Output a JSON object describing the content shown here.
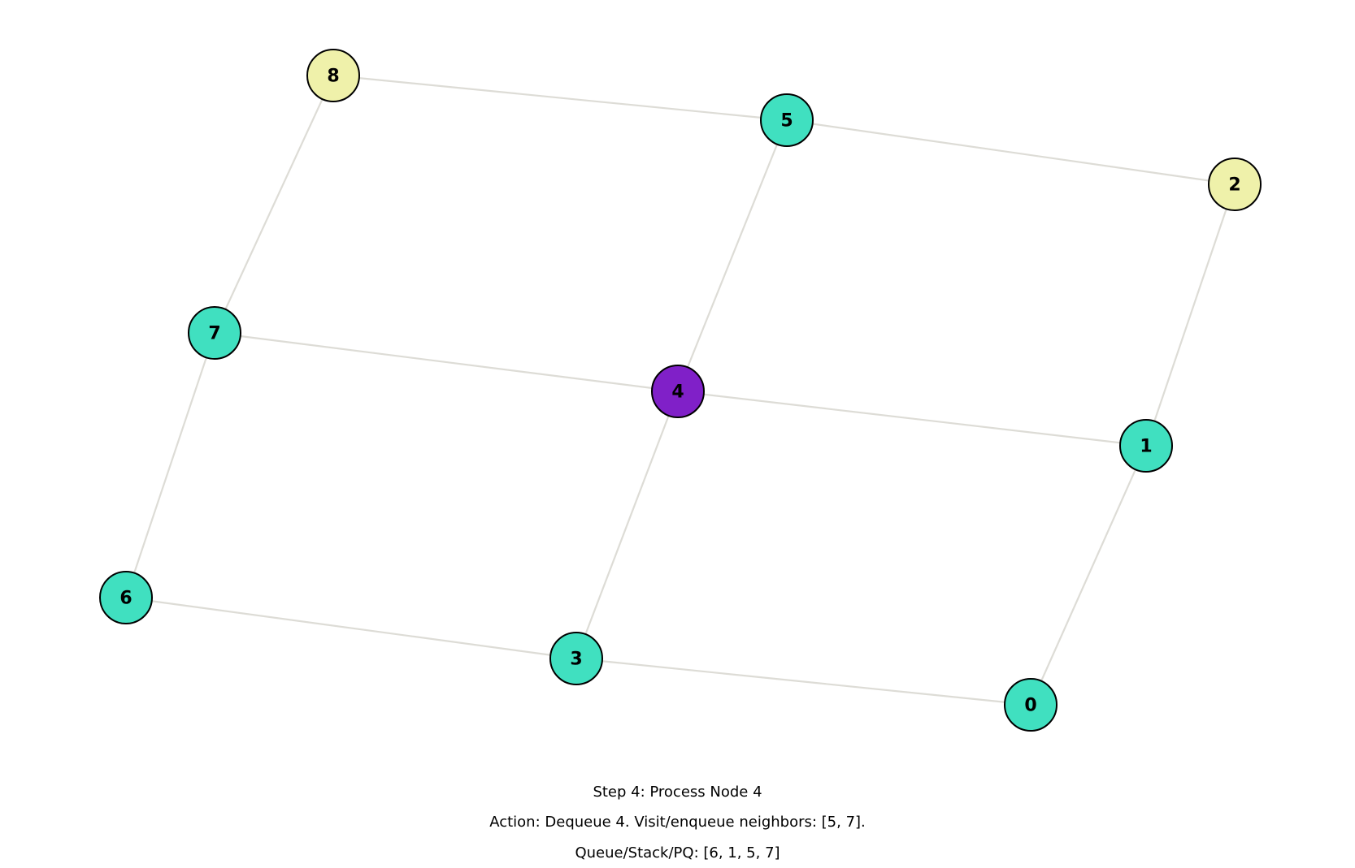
{
  "graph": {
    "colors": {
      "visited": "#40e0c0",
      "current": "#8020c8",
      "unvisited": "#eff1aa",
      "edge": "#dddcd6",
      "outline": "#000000"
    },
    "nodes": [
      {
        "id": "0",
        "label": "0",
        "state": "visited"
      },
      {
        "id": "1",
        "label": "1",
        "state": "visited"
      },
      {
        "id": "2",
        "label": "2",
        "state": "unvisited"
      },
      {
        "id": "3",
        "label": "3",
        "state": "visited"
      },
      {
        "id": "4",
        "label": "4",
        "state": "current"
      },
      {
        "id": "5",
        "label": "5",
        "state": "visited"
      },
      {
        "id": "6",
        "label": "6",
        "state": "visited"
      },
      {
        "id": "7",
        "label": "7",
        "state": "visited"
      },
      {
        "id": "8",
        "label": "8",
        "state": "unvisited"
      }
    ],
    "edges": [
      [
        "8",
        "5"
      ],
      [
        "5",
        "2"
      ],
      [
        "7",
        "4"
      ],
      [
        "4",
        "1"
      ],
      [
        "6",
        "3"
      ],
      [
        "3",
        "0"
      ],
      [
        "8",
        "7"
      ],
      [
        "7",
        "6"
      ],
      [
        "5",
        "4"
      ],
      [
        "4",
        "3"
      ],
      [
        "2",
        "1"
      ],
      [
        "1",
        "0"
      ]
    ]
  },
  "caption": {
    "step": "Step 4: Process Node 4",
    "action": "Action: Dequeue 4. Visit/enqueue neighbors: [5, 7].",
    "queue": "Queue/Stack/PQ: [6, 1, 5, 7]"
  }
}
